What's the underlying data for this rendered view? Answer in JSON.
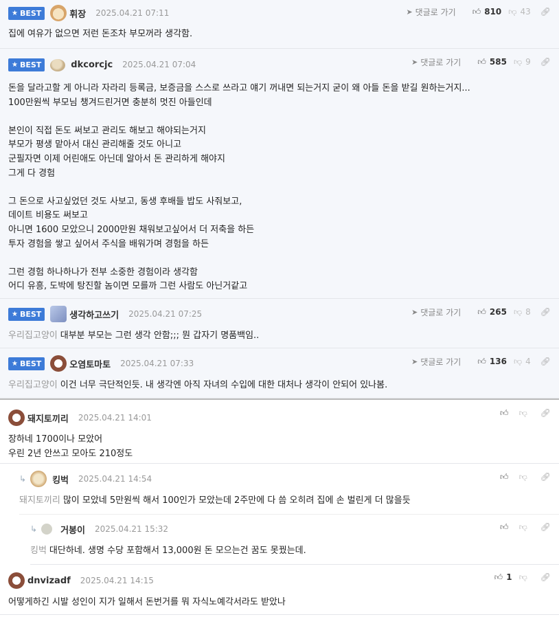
{
  "best_label": "BEST",
  "reply_label": "댓글로 가기",
  "comments": [
    {
      "name": "휘장",
      "date": "2025.04.21 07:11",
      "up": "810",
      "down": "43",
      "lines": [
        "집에 여유가 없으면 저런 돈조차 부모꺼라 생각함."
      ]
    },
    {
      "name": "dkcorcjc",
      "date": "2025.04.21 07:04",
      "up": "585",
      "down": "9",
      "lines": [
        "돈을 달라고할 게 아니라 자라리 등록금, 보증금을 스스로 쓰라고 얘기 꺼내면 되는거지 굳이 왜 아들 돈을 받길 원하는거지...",
        "100만원씩 부모님 챙겨드린거면 충분히 멋진 아들인데",
        "",
        "본인이 직접 돈도 써보고 관리도 해보고 해야되는거지",
        "부모가 평생 맡아서 대신 관리해줄 것도 아니고",
        "군필자면 이제 어린애도 아닌데 알아서 돈 관리하게 해야지",
        "그게 다 경험",
        "",
        "그 돈으로 사고싶었던 것도 사보고, 동생 후배들 밥도 사줘보고,",
        "데이트 비용도 써보고",
        "아니면 1600 모았으니 2000만원 채워보고싶어서 더 저축을 하든",
        "투자 경험을 쌓고 싶어서 주식을 배워가며 경험을 하든",
        "",
        "그런 경험 하나하나가 전부 소중한 경험이라 생각함",
        "어디 유흥, 도박에 탕진할 놈이면 모를까 그런 사람도 아닌거같고"
      ]
    },
    {
      "name": "생각하고쓰기",
      "date": "2025.04.21 07:25",
      "up": "265",
      "down": "8",
      "mention": "우리집고양이",
      "text": "대부분 부모는 그런 생각 안함;;; 뭔 갑자기 명품백임.."
    },
    {
      "name": "오염토마토",
      "date": "2025.04.21 07:33",
      "up": "136",
      "down": "4",
      "mention": "우리집고양이",
      "text": "이건 너무 극단적인듯. 내 생각엔 아직 자녀의 수입에 대한 대처나 생각이 안되어 있나봄."
    },
    {
      "name": "돼지토끼리",
      "date": "2025.04.21 14:01",
      "lines": [
        "장하네 1700이나 모았어",
        "우린 2년 안쓰고 모아도 210정도"
      ]
    },
    {
      "name": "킹벅",
      "date": "2025.04.21 14:54",
      "mention": "돼지토끼리",
      "text": "많이 모았네 5만원씩 해서 100인가 모았는데 2주만에 다 씀 오히려 집에 손 벌린게 더 많을듯"
    },
    {
      "name": "거봉이",
      "date": "2025.04.21 15:32",
      "mention": "킹벅",
      "text": "대단하네. 생명 수당 포함해서 13,000원 돈 모으는건 꿈도 못꿨는데."
    },
    {
      "name": "dnvizadf",
      "date": "2025.04.21 14:15",
      "up": "1",
      "lines": [
        "어떻게하긴 시발 성인이 지가 일해서 돈번거를 뭐 자식노예각서라도 받았나"
      ]
    }
  ]
}
